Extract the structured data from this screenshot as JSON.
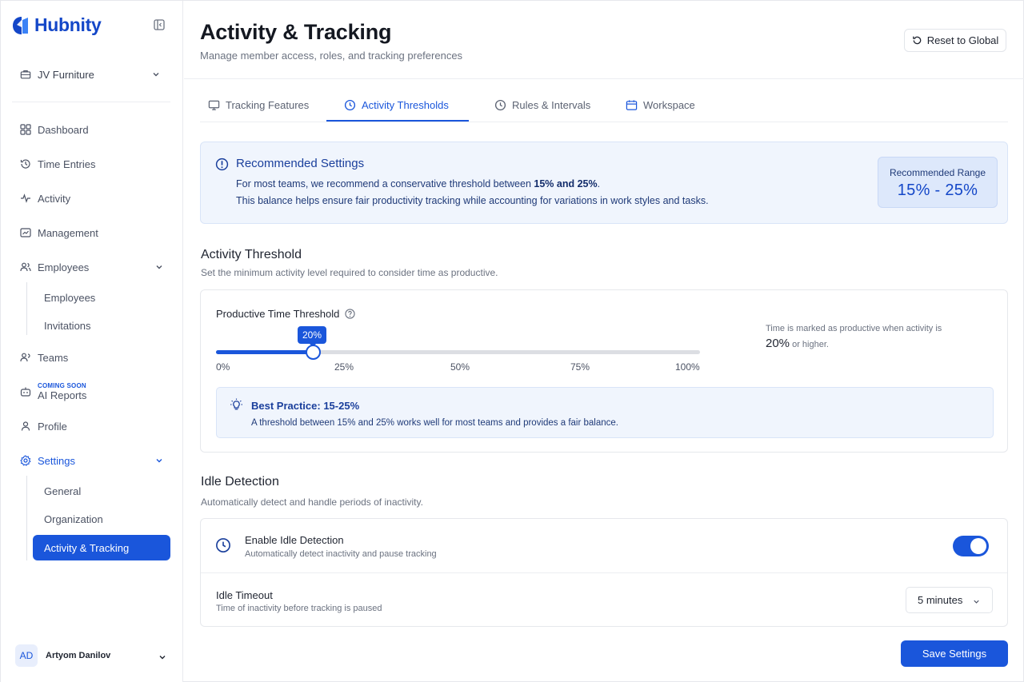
{
  "brand": {
    "name": "Hubnity",
    "color": "#1447c8"
  },
  "sidebar": {
    "workspace": "JV Furniture",
    "items": [
      {
        "label": "Dashboard",
        "icon": "grid-icon"
      },
      {
        "label": "Time Entries",
        "icon": "history-icon"
      },
      {
        "label": "Activity",
        "icon": "pulse-icon"
      },
      {
        "label": "Management",
        "icon": "chart-box-icon"
      },
      {
        "label": "Employees",
        "icon": "users-icon"
      },
      {
        "label": "Teams",
        "icon": "team-icon"
      },
      {
        "label": "AI Reports",
        "badge": "COMING SOON",
        "icon": "robot-icon"
      },
      {
        "label": "Profile",
        "icon": "user-icon"
      },
      {
        "label": "Settings",
        "icon": "gear-icon"
      }
    ],
    "employees_sub": [
      "Employees",
      "Invitations"
    ],
    "settings_sub": [
      "General",
      "Organization",
      "Activity & Tracking"
    ],
    "user": {
      "initials": "AD",
      "name": "Artyom Danilov"
    }
  },
  "header": {
    "title": "Activity & Tracking",
    "subtitle": "Manage member access, roles, and tracking preferences",
    "reset_label": "Reset to Global"
  },
  "tabs": [
    {
      "label": "Tracking Features",
      "icon": "monitor-icon"
    },
    {
      "label": "Activity Thresholds",
      "icon": "clock-icon",
      "active": true
    },
    {
      "label": "Rules & Intervals",
      "icon": "clock-icon"
    },
    {
      "label": "Workspace",
      "icon": "calendar-icon"
    }
  ],
  "recommended": {
    "title": "Recommended Settings",
    "line1_prefix": "For most teams, we recommend a conservative threshold between ",
    "line1_bold": "15% and 25%",
    "line1_suffix": ".",
    "line2": "This balance helps ensure fair productivity tracking while accounting for variations in work styles and tasks.",
    "range_label": "Recommended Range",
    "range_value": "15% - 25%"
  },
  "threshold": {
    "title": "Activity Threshold",
    "subtitle": "Set the minimum activity level required to consider time as productive.",
    "label": "Productive Time Threshold",
    "value": 20,
    "bubble": "20%",
    "ticks": [
      "0%",
      "25%",
      "50%",
      "75%",
      "100%"
    ],
    "note": "Time is marked as productive when activity is",
    "note_value": "20%",
    "note_suffix": " or higher.",
    "best_title": "Best Practice: 15-25%",
    "best_text": "A threshold between 15% and 25% works well for most teams and provides a fair balance."
  },
  "idle": {
    "title": "Idle Detection",
    "subtitle": "Automatically detect and handle periods of inactivity.",
    "enable_title": "Enable Idle Detection",
    "enable_sub": "Automatically detect inactivity and pause tracking",
    "enabled": true,
    "timeout_title": "Idle Timeout",
    "timeout_sub": "Time of inactivity before tracking is paused",
    "timeout_value": "5 minutes"
  },
  "footer": {
    "save_label": "Save Settings"
  },
  "colors": {
    "accent": "#1a56db",
    "info_bg": "#f0f5fd"
  }
}
